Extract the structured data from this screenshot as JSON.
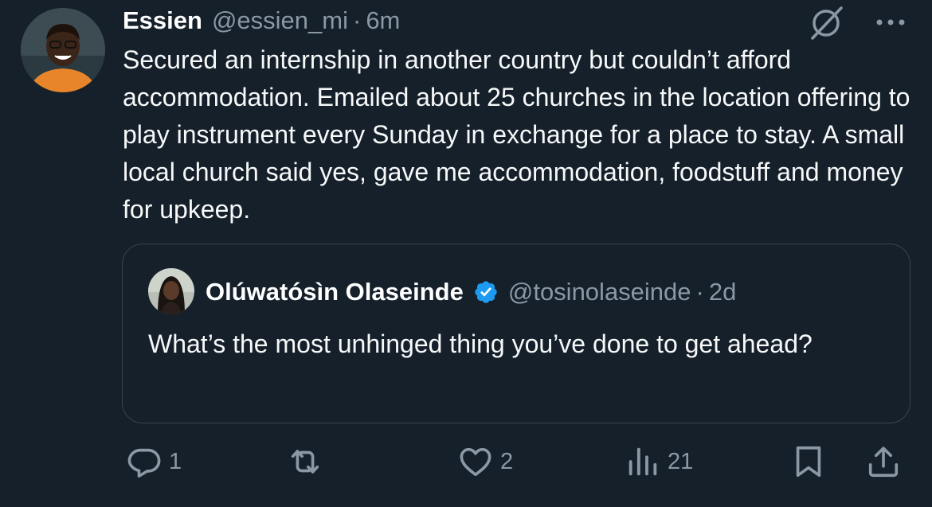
{
  "tweet": {
    "author_name": "Essien",
    "author_handle": "@essien_mi",
    "separator": "·",
    "time": "6m",
    "text": "Secured an internship in another country but couldn’t afford accommodation. Emailed about 25 churches in the location offering to play instrument every Sunday in exchange for a place to stay. A small local church said yes, gave me accommodation, foodstuff and money for upkeep."
  },
  "quoted_tweet": {
    "author_name": "Olúwatósìn Olaseinde",
    "verified": true,
    "author_handle": "@tosinolaseinde",
    "separator": "·",
    "time": "2d",
    "text": "What’s the most unhinged thing you’ve done to get ahead?"
  },
  "actions": {
    "reply_count": "1",
    "retweet_count": "",
    "like_count": "2",
    "views_count": "21"
  },
  "icons": {
    "grok": "grok-icon",
    "more": "more-icon",
    "verified": "verified-badge-icon",
    "reply": "reply-icon",
    "retweet": "retweet-icon",
    "like": "heart-icon",
    "views": "views-icon",
    "bookmark": "bookmark-icon",
    "share": "share-icon"
  },
  "colors": {
    "background": "#15202b",
    "secondary_text": "#8b98a5",
    "border": "#38444d",
    "verified_blue": "#1d9bf0"
  }
}
